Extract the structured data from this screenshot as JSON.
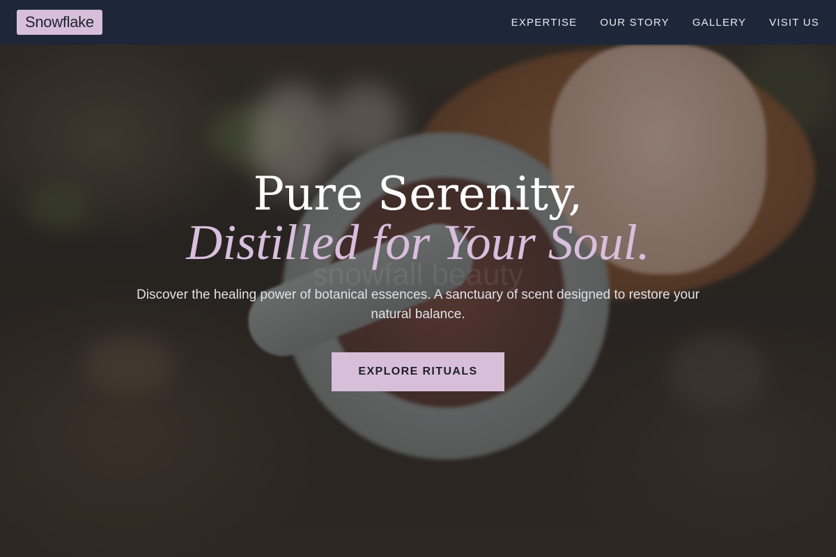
{
  "brand": {
    "logo_text": "Snowflake",
    "accent_color": "#d7bfd9"
  },
  "nav": {
    "items": [
      {
        "label": "EXPERTISE"
      },
      {
        "label": "OUR STORY"
      },
      {
        "label": "GALLERY"
      },
      {
        "label": "VISIT US"
      }
    ]
  },
  "hero": {
    "headline_line1": "Pure Serenity,",
    "headline_line2": "Distilled for Your Soul.",
    "subtext": "Discover the healing power of botanical essences. A sanctuary of scent designed to restore your natural balance.",
    "cta_label": "EXPLORE RITUALS",
    "watermark_text": "snowfall beauty"
  }
}
